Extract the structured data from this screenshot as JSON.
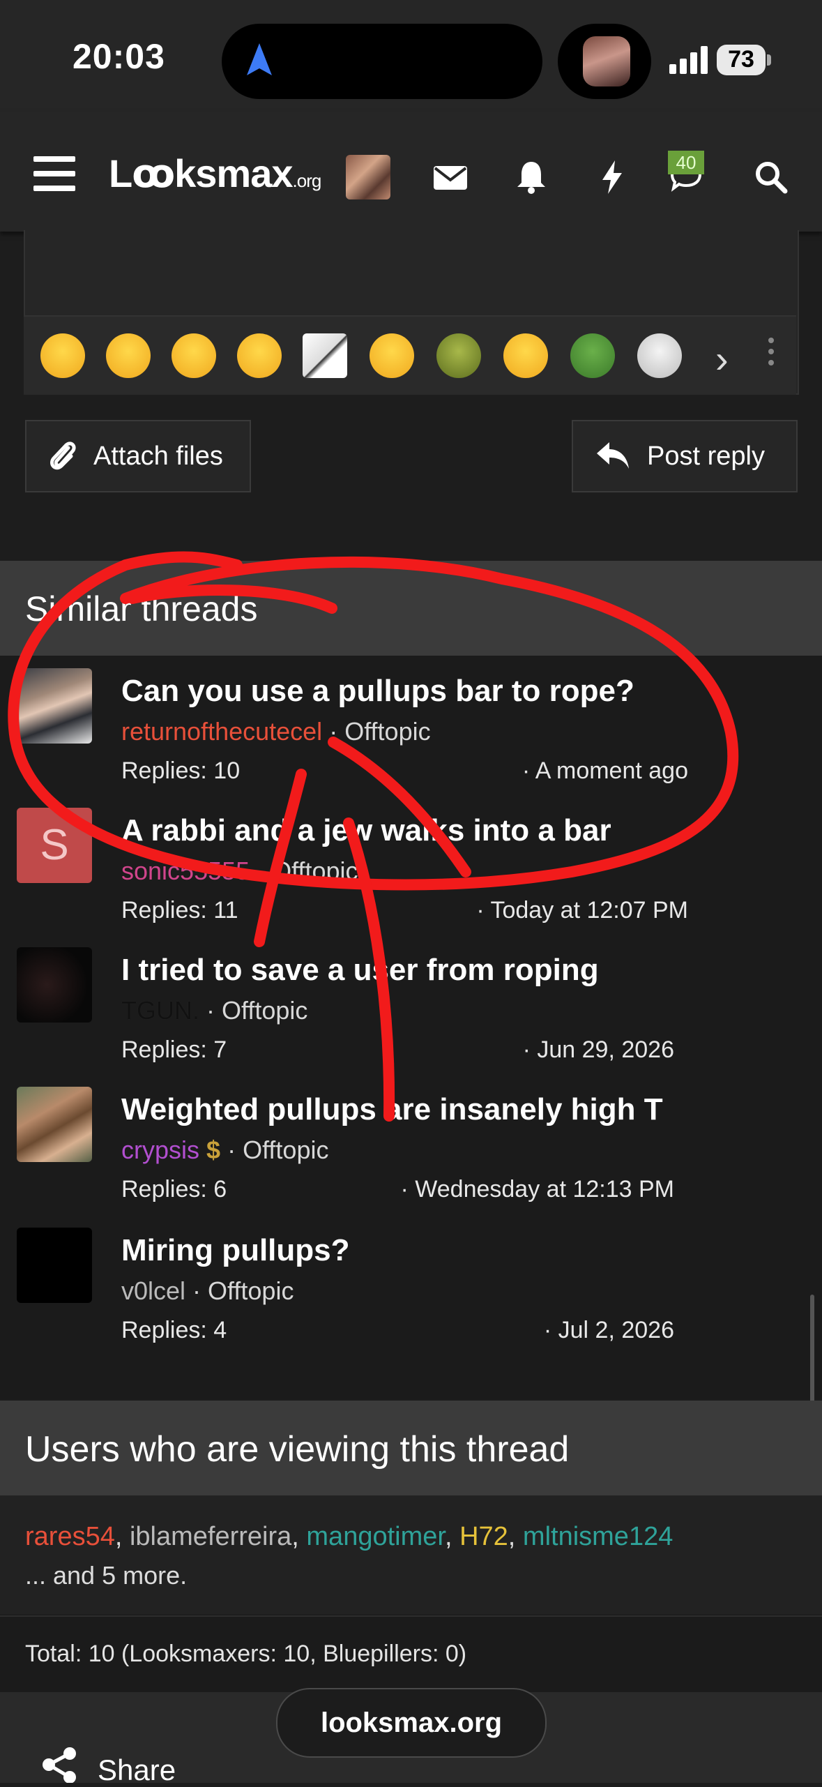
{
  "status_bar": {
    "time": "20:03",
    "battery": "73"
  },
  "nav": {
    "logo_main": "Lꝏksmax",
    "logo_suffix": ".org",
    "messages_badge": "40"
  },
  "composer": {
    "emojis": [
      "loudly-crying",
      "crying",
      "tongue-out",
      "pleading",
      "smug-meme",
      "frowning",
      "shrek",
      "grinning",
      "pepe",
      "wojak"
    ],
    "attach_label": "Attach files",
    "reply_label": "Post reply"
  },
  "similar_threads": {
    "heading": "Similar threads",
    "threads": [
      {
        "title": "Can you use a pullups bar to rope?",
        "author": "returnofthecutecel",
        "author_color": "#e8503a",
        "forum": "Offtopic",
        "replies": "Replies: 10",
        "date": "· A moment ago",
        "avatar": "photo-young-man"
      },
      {
        "title": "A rabbi and a jew walks into a bar",
        "author": "sonic55555",
        "author_color": "#d1458c",
        "forum": "Offtopic",
        "replies": "Replies: 11",
        "date": "· Today at 12:07 PM",
        "avatar": "letter-s"
      },
      {
        "title": "I tried to save a user from roping",
        "author": "TGUN.",
        "author_color": "#111111",
        "forum": "Offtopic",
        "replies": "Replies: 7",
        "date": "· Jun 29, 2026",
        "avatar": "dark-photo"
      },
      {
        "title": "Weighted pullups are insanely high T",
        "author": "crypsis",
        "author_color": "#b24fd0",
        "forum": "Offtopic",
        "replies": "Replies: 6",
        "date": "· Wednesday at 12:13 PM",
        "avatar": "photo-woman"
      },
      {
        "title": "Miring pullups?",
        "author": "v0lcel",
        "author_color": "#bbbbbb",
        "forum": "Offtopic",
        "replies": "Replies: 4",
        "date": "· Jul 2, 2026",
        "avatar": "black-square"
      }
    ]
  },
  "viewing": {
    "heading": "Users who are viewing this thread",
    "users": [
      {
        "name": "rares54",
        "color": "#e8503a"
      },
      {
        "name": "iblameferreira",
        "color": "#bbbbbb"
      },
      {
        "name": "mangotimer",
        "color": "#2fa39a"
      },
      {
        "name": "H72",
        "color": "#e6c23a"
      },
      {
        "name": "mltnisme124",
        "color": "#2fa39a"
      }
    ],
    "more": "... and 5 more.",
    "total": "Total: 10 (Looksmaxers: 10, Bluepillers: 0)"
  },
  "footer": {
    "url": "looksmax.org",
    "share_label": "Share"
  }
}
